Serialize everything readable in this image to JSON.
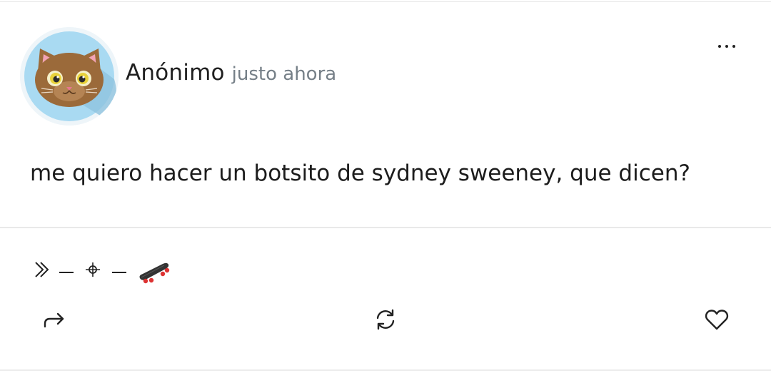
{
  "post": {
    "author": "Anónimo",
    "time": "justo ahora",
    "text": "me quiero hacer un botsito de sydney sweeney, que dicen?",
    "signature_icons": [
      "double-chevron-icon",
      "dash-icon",
      "crosshair-icon",
      "dash-icon",
      "skateboard-icon"
    ]
  },
  "actions": {
    "icons": [
      "share-icon",
      "repost-icon",
      "heart-icon",
      "more-icon"
    ]
  },
  "colors": {
    "avatar_bg": "#a9daf2",
    "cat_fur": "#9b6a3a",
    "cat_ear_inner": "#f2a3b5",
    "cat_eye": "#e8d23a",
    "muted_text": "#757f87"
  }
}
